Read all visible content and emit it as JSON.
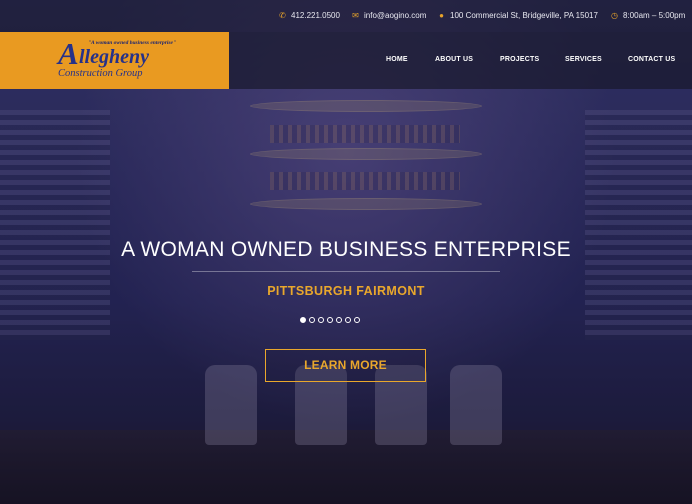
{
  "topbar": {
    "phone": "412.221.0500",
    "email": "info@aogino.com",
    "address": "100 Commercial St, Bridgeville, PA 15017",
    "hours": "8:00am – 5:00pm",
    "icons": {
      "phone": "phone-icon",
      "email": "envelope-icon",
      "address": "map-marker-icon",
      "hours": "clock-icon"
    }
  },
  "logo": {
    "tagline": "\"A woman owned business enterprise\"",
    "initial": "A",
    "name": "llegheny",
    "subtitle": "Construction Group"
  },
  "nav": {
    "items": [
      {
        "label": "HOME"
      },
      {
        "label": "ABOUT US"
      },
      {
        "label": "PROJECTS"
      },
      {
        "label": "SERVICES"
      },
      {
        "label": "CONTACT US"
      }
    ]
  },
  "hero": {
    "headline": "A WOMAN OWNED BUSINESS ENTERPRISE",
    "subheadline": "PITTSBURGH FAIRMONT",
    "slide_count": 7,
    "active_slide": 1,
    "cta_label": "LEARN MORE"
  },
  "colors": {
    "accent": "#e9a72c",
    "logo_bg": "#e99a21",
    "logo_text": "#263189",
    "overlay": "#2c2c5c"
  }
}
